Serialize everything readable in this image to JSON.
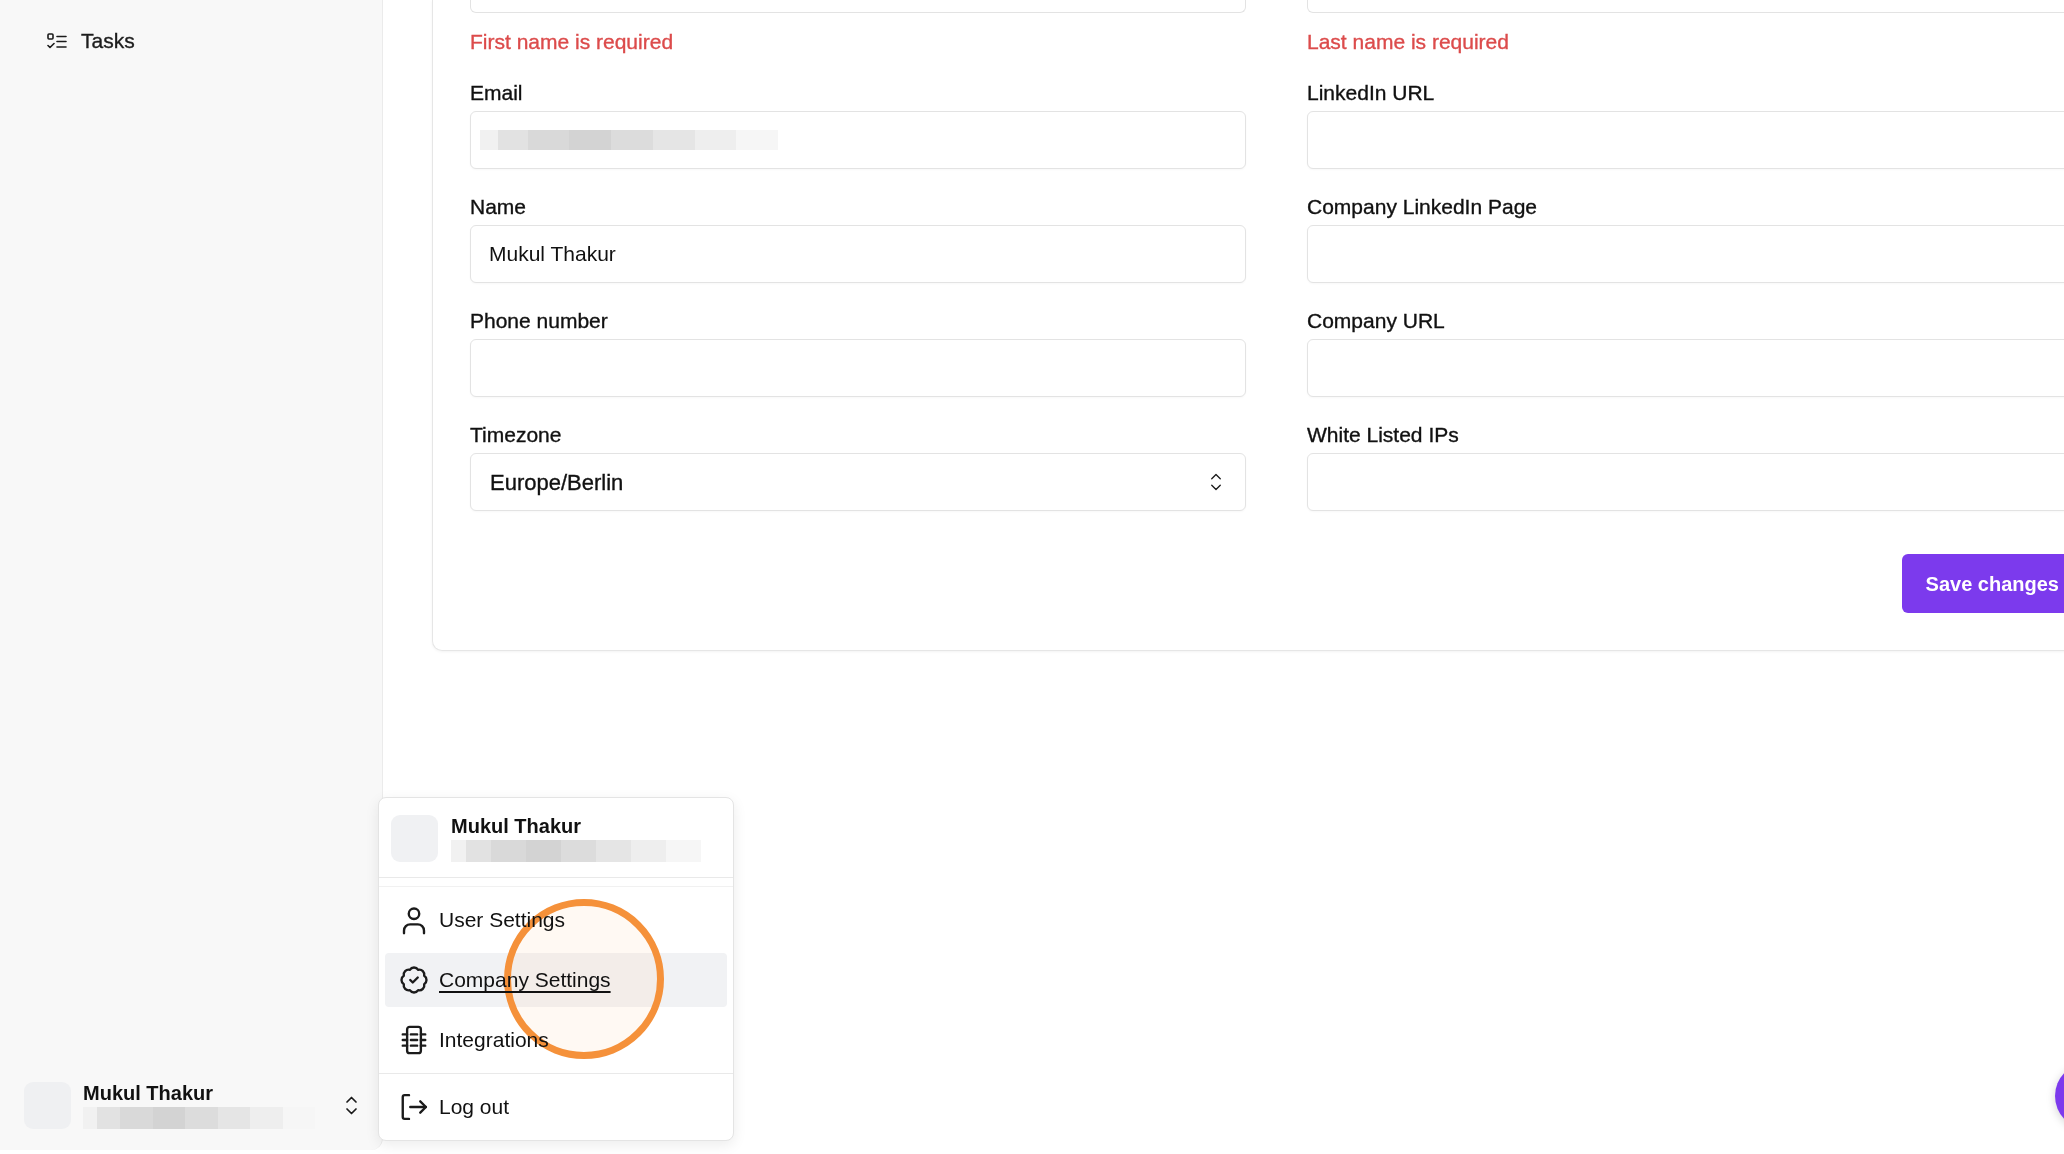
{
  "sidebar": {
    "items": [
      {
        "label": "Tasks"
      }
    ],
    "user": {
      "name": "Mukul Thakur",
      "email_blurred": true
    }
  },
  "form": {
    "columns": [
      {
        "fields": [
          {
            "kind": "cut_off",
            "error": "First name is required"
          },
          {
            "kind": "text",
            "label": "Email",
            "value_blurred": true
          },
          {
            "kind": "text",
            "label": "Name",
            "value": "Mukul Thakur"
          },
          {
            "kind": "text",
            "label": "Phone number"
          },
          {
            "kind": "select",
            "label": "Timezone",
            "value": "Europe/Berlin"
          }
        ]
      },
      {
        "fields": [
          {
            "kind": "cut_off",
            "error": "Last name is required"
          },
          {
            "kind": "text",
            "label": "LinkedIn URL"
          },
          {
            "kind": "text",
            "label": "Company LinkedIn Page"
          },
          {
            "kind": "text",
            "label": "Company URL"
          },
          {
            "kind": "text",
            "label": "White Listed IPs"
          }
        ]
      }
    ],
    "save_button": "Save changes"
  },
  "account_menu": {
    "user": {
      "name": "Mukul Thakur",
      "email_blurred": true
    },
    "items": [
      {
        "label": "User Settings",
        "hovered": false
      },
      {
        "label": "Company Settings",
        "hovered": true
      },
      {
        "label": "Integrations",
        "hovered": false
      }
    ],
    "footer_items": [
      {
        "label": "Log out"
      }
    ]
  },
  "click_highlight": true,
  "floating_button": true
}
